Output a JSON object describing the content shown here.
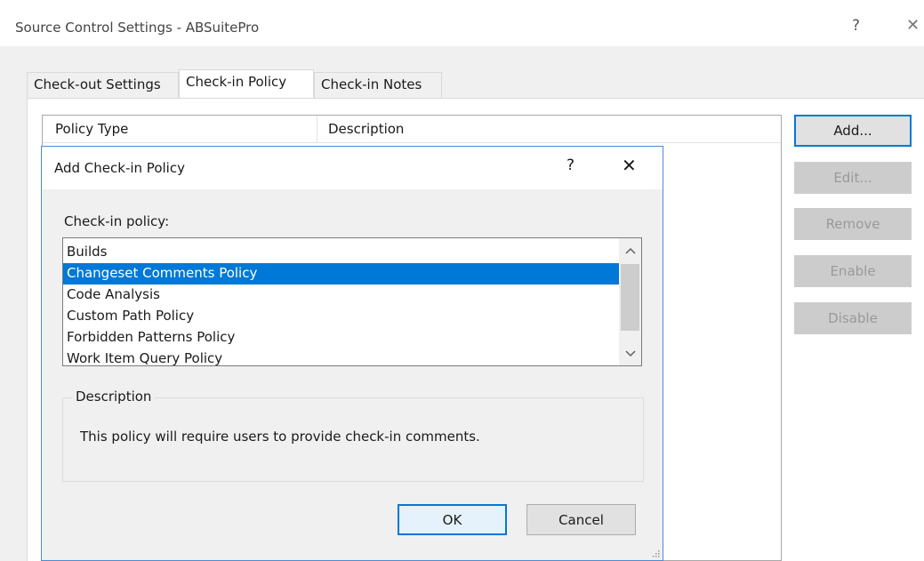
{
  "window": {
    "title": "Source Control Settings - ABSuitePro",
    "help_glyph": "?",
    "close_glyph": "✕"
  },
  "tabs": [
    {
      "label": "Check-out Settings",
      "active": false
    },
    {
      "label": "Check-in Policy",
      "active": true
    },
    {
      "label": "Check-in Notes",
      "active": false
    }
  ],
  "policy_list": {
    "columns": [
      "Policy Type",
      "Description"
    ]
  },
  "side_buttons": {
    "add": "Add...",
    "edit": "Edit...",
    "remove": "Remove",
    "enable": "Enable",
    "disable": "Disable"
  },
  "dialog": {
    "title": "Add Check-in Policy",
    "help_glyph": "?",
    "close_glyph": "✕",
    "policy_label": "Check-in policy:",
    "policies": [
      "Builds",
      "Changeset Comments Policy",
      "Code Analysis",
      "Custom Path Policy",
      "Forbidden Patterns Policy",
      "Work Item Query Policy"
    ],
    "selected_index": 1,
    "description_label": "Description",
    "description_text": "This policy will require users to provide check-in comments.",
    "ok_label": "OK",
    "cancel_label": "Cancel"
  },
  "colors": {
    "accent": "#0078d7",
    "selection_text": "#ffffff",
    "dialog_border": "#4a8bd8",
    "disabled_button": "#cccccc"
  },
  "icons": {
    "scroll_up": "chevron-up-icon",
    "scroll_down": "chevron-down-icon",
    "close": "close-icon",
    "help": "help-icon",
    "resize": "resize-grip-icon"
  }
}
